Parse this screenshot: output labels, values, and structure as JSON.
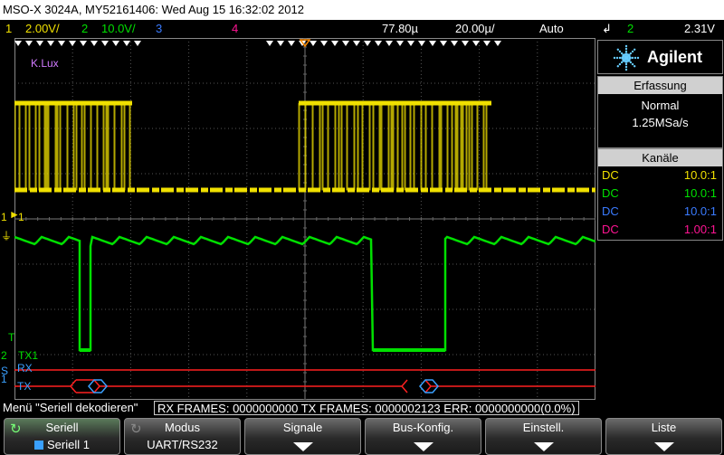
{
  "title_bar": "MSO-X 3024A, MY52161406: Wed Aug 15 16:32:02 2012",
  "status_bar": {
    "ch1_num": "1",
    "ch1_scale": "2.00V/",
    "ch2_num": "2",
    "ch2_scale": "10.0V/",
    "ch3_num": "3",
    "ch4_num": "4",
    "trigger_delay": "77.80µ",
    "timebase": "20.00µ/",
    "trigger_mode": "Auto",
    "trigger_source": "2",
    "trigger_level": "2.31V"
  },
  "waveform_labels": {
    "probe_label": "K.Lux",
    "ch1_marker": "1",
    "ch1_arrow": "1",
    "ch2_marker": "2",
    "tx1_label": "TX1",
    "rx_label": "RX",
    "tx_label": "TX",
    "serial_s": "S",
    "serial_1": "1",
    "t_marker": "T"
  },
  "brand": "Agilent",
  "acquisition": {
    "header": "Erfassung",
    "mode": "Normal",
    "sample_rate": "1.25MSa/s"
  },
  "channels": {
    "header": "Kanäle",
    "rows": [
      {
        "coupling": "DC",
        "ratio": "10.0:1",
        "color": "#f0e000"
      },
      {
        "coupling": "DC",
        "ratio": "10.0:1",
        "color": "#00e000"
      },
      {
        "coupling": "DC",
        "ratio": "10.0:1",
        "color": "#3a7bff"
      },
      {
        "coupling": "DC",
        "ratio": "1.00:1",
        "color": "#ff1493"
      }
    ]
  },
  "menu": {
    "title": "Menü \"Seriell dekodieren\"",
    "stats": "RX FRAMES: 0000000000  TX FRAMES: 0000002123  ERR: 0000000000(0.0%)"
  },
  "softkeys": [
    {
      "top": "Seriell",
      "bottom": "Seriell 1",
      "arrow": false
    },
    {
      "top": "Modus",
      "bottom": "UART/RS232",
      "arrow": false
    },
    {
      "top": "Signale",
      "bottom": "",
      "arrow": true
    },
    {
      "top": "Bus-Konfig.",
      "bottom": "",
      "arrow": true
    },
    {
      "top": "Einstell.",
      "bottom": "",
      "arrow": true
    },
    {
      "top": "Liste",
      "bottom": "",
      "arrow": true
    }
  ],
  "colors": {
    "ch1": "#f0e000",
    "ch2": "#00e000",
    "ch3": "#3a7bff",
    "ch4": "#ff1493",
    "decode_red": "#ff2020",
    "decode_blue": "#3aa0ff",
    "trigger_orange": "#ff8c00",
    "grid": "#555555"
  },
  "icons": {
    "softkey_1": "refresh-icon",
    "softkey_2": "refresh-icon",
    "brand": "agilent-spark-icon",
    "softkey_arrows": "down-arrow-icon"
  }
}
